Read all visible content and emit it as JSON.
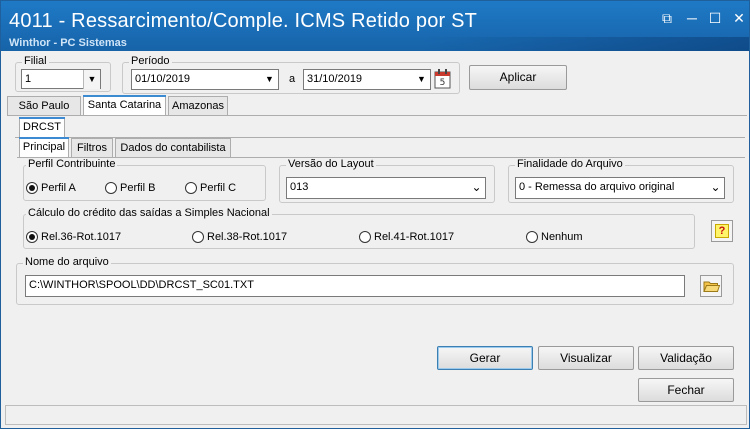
{
  "window": {
    "title": "4011 - Ressarcimento/Comple. ICMS Retido por ST",
    "subtitle": "Winthor - PC Sistemas",
    "controls": {
      "restore": "⧉",
      "minimize": "─",
      "maximize": "☐",
      "close": "✕"
    }
  },
  "filial": {
    "label": "Filial",
    "value": "1"
  },
  "periodo": {
    "label": "Período",
    "start": "01/10/2019",
    "separator": "a",
    "end": "31/10/2019"
  },
  "apply_label": "Aplicar",
  "state_tabs": [
    {
      "label": "São Paulo",
      "active": false
    },
    {
      "label": "Santa Catarina",
      "active": true
    },
    {
      "label": "Amazonas",
      "active": false
    }
  ],
  "sub_tab": {
    "label": "DRCST"
  },
  "inner_tabs": [
    {
      "label": "Principal",
      "active": true
    },
    {
      "label": "Filtros",
      "active": false
    },
    {
      "label": "Dados do contabilista",
      "active": false
    }
  ],
  "perfil": {
    "label": "Perfil Contribuinte",
    "options": [
      "Perfil A",
      "Perfil B",
      "Perfil C"
    ],
    "selected": "Perfil A"
  },
  "versao": {
    "label": "Versão do Layout",
    "value": "013"
  },
  "finalidade": {
    "label": "Finalidade do Arquivo",
    "value": "0 - Remessa do arquivo original"
  },
  "calculo": {
    "label": "Cálculo do crédito das saídas a Simples Nacional",
    "options": [
      "Rel.36-Rot.1017",
      "Rel.38-Rot.1017",
      "Rel.41-Rot.1017",
      "Nenhum"
    ],
    "selected": "Rel.36-Rot.1017",
    "help_icon": "?"
  },
  "arquivo": {
    "label": "Nome do arquivo",
    "value": "C:\\WINTHOR\\SPOOL\\DD\\DRCST_SC01.TXT"
  },
  "buttons": {
    "gerar": "Gerar",
    "visualizar": "Visualizar",
    "validacao": "Validação",
    "fechar": "Fechar"
  },
  "colors": {
    "title_bar": "#1a6db6",
    "tab_accent": "#3b8ad2",
    "help_bg": "#fff46a"
  }
}
